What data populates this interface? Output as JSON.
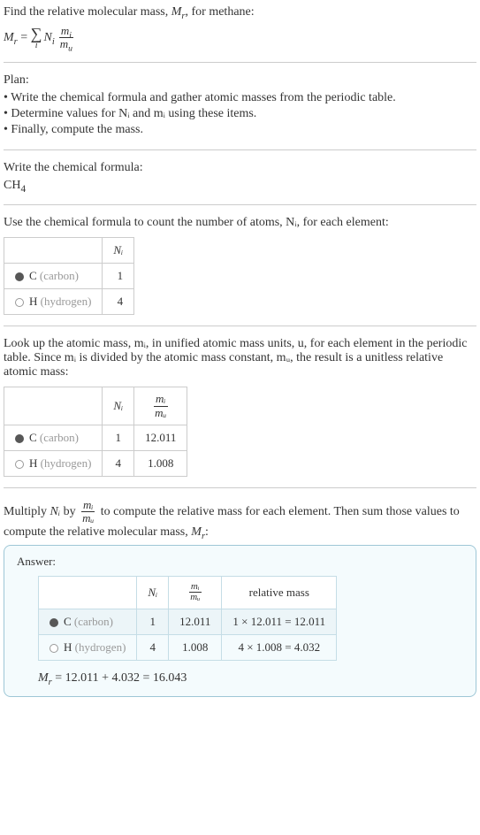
{
  "intro": {
    "line1_pre": "Find the relative molecular mass, ",
    "line1_post": ", for methane:",
    "Mr": "M",
    "r_sub": "r",
    "Ni": "N",
    "i_sub": "i",
    "mi": "m",
    "mu": "m",
    "u_sub": "u"
  },
  "plan": {
    "title": "Plan:",
    "items": [
      "Write the chemical formula and gather atomic masses from the periodic table.",
      "Determine values for Nᵢ and mᵢ using these items.",
      "Finally, compute the mass."
    ]
  },
  "chem": {
    "title": "Write the chemical formula:",
    "formula_prefix": "CH",
    "formula_sub": "4"
  },
  "count": {
    "title": "Use the chemical formula to count the number of atoms, Nᵢ, for each element:",
    "header_ni": "Nᵢ",
    "rows": [
      {
        "sym": "C",
        "name": "(carbon)",
        "dot": "dot-c",
        "ni": "1"
      },
      {
        "sym": "H",
        "name": "(hydrogen)",
        "dot": "dot-h",
        "ni": "4"
      }
    ]
  },
  "mass": {
    "title": "Look up the atomic mass, mᵢ, in unified atomic mass units, u, for each element in the periodic table. Since mᵢ is divided by the atomic mass constant, mᵤ, the result is a unitless relative atomic mass:",
    "header_ni": "Nᵢ",
    "header_frac_num": "mᵢ",
    "header_frac_den": "mᵤ",
    "rows": [
      {
        "sym": "C",
        "name": "(carbon)",
        "dot": "dot-c",
        "ni": "1",
        "mass": "12.011"
      },
      {
        "sym": "H",
        "name": "(hydrogen)",
        "dot": "dot-h",
        "ni": "4",
        "mass": "1.008"
      }
    ]
  },
  "final": {
    "text_pre": "Multiply ",
    "text_mid": " by ",
    "text_post": " to compute the relative mass for each element. Then sum those values to compute the relative molecular mass, ",
    "colon": ":",
    "Ni": "Nᵢ",
    "frac_num": "mᵢ",
    "frac_den": "mᵤ",
    "Mr": "M",
    "r_sub": "r"
  },
  "answer": {
    "label": "Answer:",
    "header_ni": "Nᵢ",
    "header_frac_num": "mᵢ",
    "header_frac_den": "mᵤ",
    "header_rel": "relative mass",
    "rows": [
      {
        "sym": "C",
        "name": "(carbon)",
        "dot": "dot-c",
        "ni": "1",
        "mass": "12.011",
        "rel": "1 × 12.011 = 12.011"
      },
      {
        "sym": "H",
        "name": "(hydrogen)",
        "dot": "dot-h",
        "ni": "4",
        "mass": "1.008",
        "rel": "4 × 1.008 = 4.032"
      }
    ],
    "result_pre": "M",
    "result_sub": "r",
    "result_post": " = 12.011 + 4.032 = 16.043"
  },
  "chart_data": {
    "type": "table",
    "elements": [
      {
        "symbol": "C",
        "name": "carbon",
        "Ni": 1,
        "atomic_mass": 12.011,
        "relative_mass": 12.011
      },
      {
        "symbol": "H",
        "name": "hydrogen",
        "Ni": 4,
        "atomic_mass": 1.008,
        "relative_mass": 4.032
      }
    ],
    "molecular_formula": "CH4",
    "relative_molecular_mass": 16.043
  }
}
